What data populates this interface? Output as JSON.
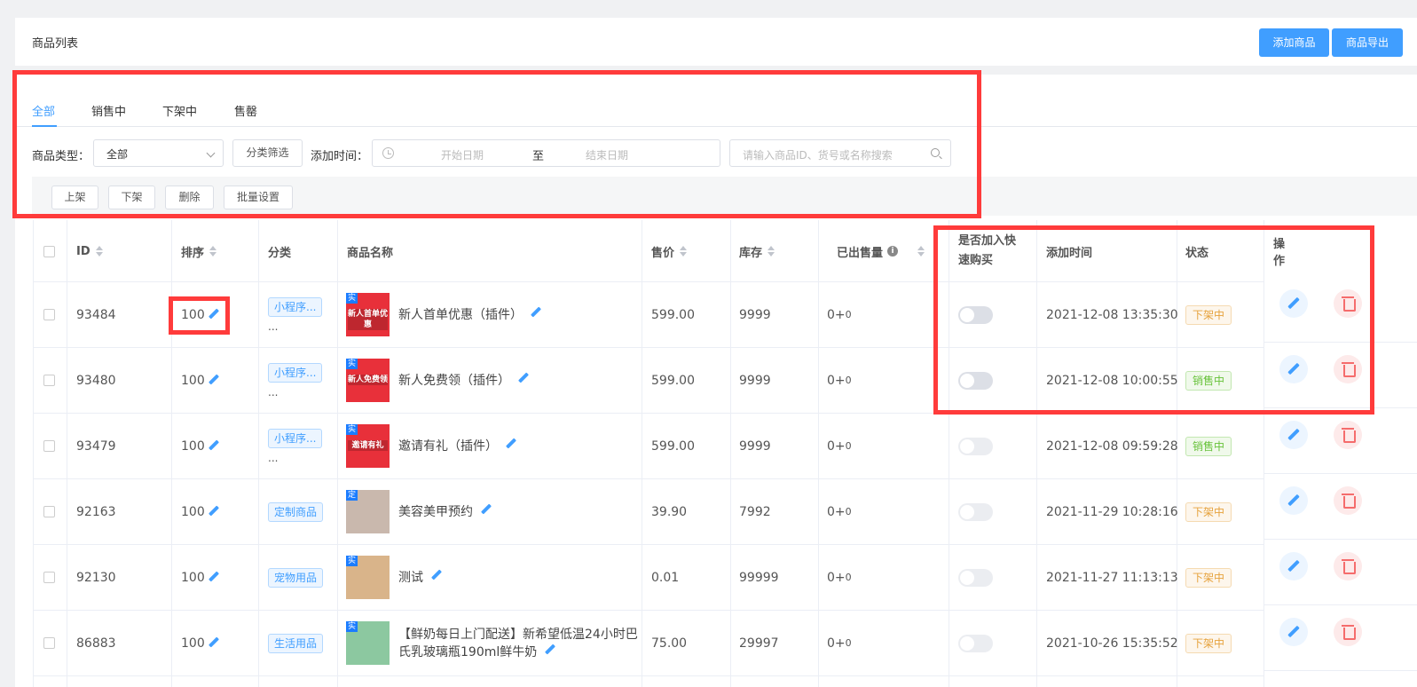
{
  "header": {
    "title": "商品列表",
    "add_button": "添加商品",
    "export_button": "商品导出"
  },
  "tabs": [
    {
      "label": "全部",
      "active": true
    },
    {
      "label": "销售中",
      "active": false
    },
    {
      "label": "下架中",
      "active": false
    },
    {
      "label": "售罄",
      "active": false
    }
  ],
  "filters": {
    "type_label": "商品类型：",
    "type_value": "全部",
    "category_button": "分类筛选",
    "time_label": "添加时间：",
    "start_placeholder": "开始日期",
    "range_separator": "至",
    "end_placeholder": "结束日期",
    "search_placeholder": "请输入商品ID、货号或名称搜索"
  },
  "batch_actions": [
    "上架",
    "下架",
    "删除",
    "批量设置"
  ],
  "columns": {
    "id": "ID",
    "sort": "排序",
    "category": "分类",
    "name": "商品名称",
    "price": "售价",
    "stock": "库存",
    "sold": "已出售量",
    "quick_buy_line1": "是否加入快",
    "quick_buy_line2": "速购买",
    "added_time": "添加时间",
    "status": "状态",
    "actions": "操作"
  },
  "rows": [
    {
      "id": "93484",
      "sort": "100",
      "category": "小程序...",
      "category_more": "...",
      "corner": "实",
      "caption": "新人首单优惠",
      "thumb_color": "#e8303a",
      "name": "新人首单优惠（插件）",
      "price": "599.00",
      "stock": "9999",
      "sold": "0+",
      "sold_extra": "0",
      "time": "2021-12-08 13:35:30",
      "status": "下架中",
      "status_kind": "off"
    },
    {
      "id": "93480",
      "sort": "100",
      "category": "小程序...",
      "category_more": "...",
      "corner": "实",
      "caption": "新人免费领",
      "thumb_color": "#e8303a",
      "name": "新人免费领（插件）",
      "price": "599.00",
      "stock": "9999",
      "sold": "0+",
      "sold_extra": "0",
      "time": "2021-12-08 10:00:55",
      "status": "销售中",
      "status_kind": "on"
    },
    {
      "id": "93479",
      "sort": "100",
      "category": "小程序...",
      "category_more": "...",
      "corner": "实",
      "caption": "邀请有礼",
      "thumb_color": "#e8303a",
      "name": "邀请有礼（插件）",
      "price": "599.00",
      "stock": "9999",
      "sold": "0+",
      "sold_extra": "0",
      "time": "2021-12-08 09:59:28",
      "status": "销售中",
      "status_kind": "on"
    },
    {
      "id": "92163",
      "sort": "100",
      "category": "定制商品",
      "category_more": "",
      "corner": "定",
      "caption": "",
      "thumb_color": "#c9b8ad",
      "name": "美容美甲预约",
      "price": "39.90",
      "stock": "7992",
      "sold": "0+",
      "sold_extra": "0",
      "time": "2021-11-29 10:28:16",
      "status": "下架中",
      "status_kind": "off"
    },
    {
      "id": "92130",
      "sort": "100",
      "category": "宠物用品",
      "category_more": "",
      "corner": "实",
      "caption": "",
      "thumb_color": "#d9b48a",
      "name": "测试",
      "price": "0.01",
      "stock": "99999",
      "sold": "0+",
      "sold_extra": "0",
      "time": "2021-11-27 11:13:13",
      "status": "下架中",
      "status_kind": "off"
    },
    {
      "id": "86883",
      "sort": "100",
      "category": "生活用品",
      "category_more": "",
      "corner": "实",
      "caption": "",
      "thumb_color": "#8cc8a0",
      "name": "【鲜奶每日上门配送】新希望低温24小时巴氏乳玻璃瓶190ml鲜牛奶",
      "price": "75.00",
      "stock": "29997",
      "sold": "0+",
      "sold_extra": "0",
      "time": "2021-10-26 15:35:52",
      "status": "下架中",
      "status_kind": "off"
    }
  ],
  "colors": {
    "primary": "#409eff",
    "highlight": "#ff3b3b",
    "off_status": "#e6a23c",
    "on_status": "#67c23a"
  }
}
